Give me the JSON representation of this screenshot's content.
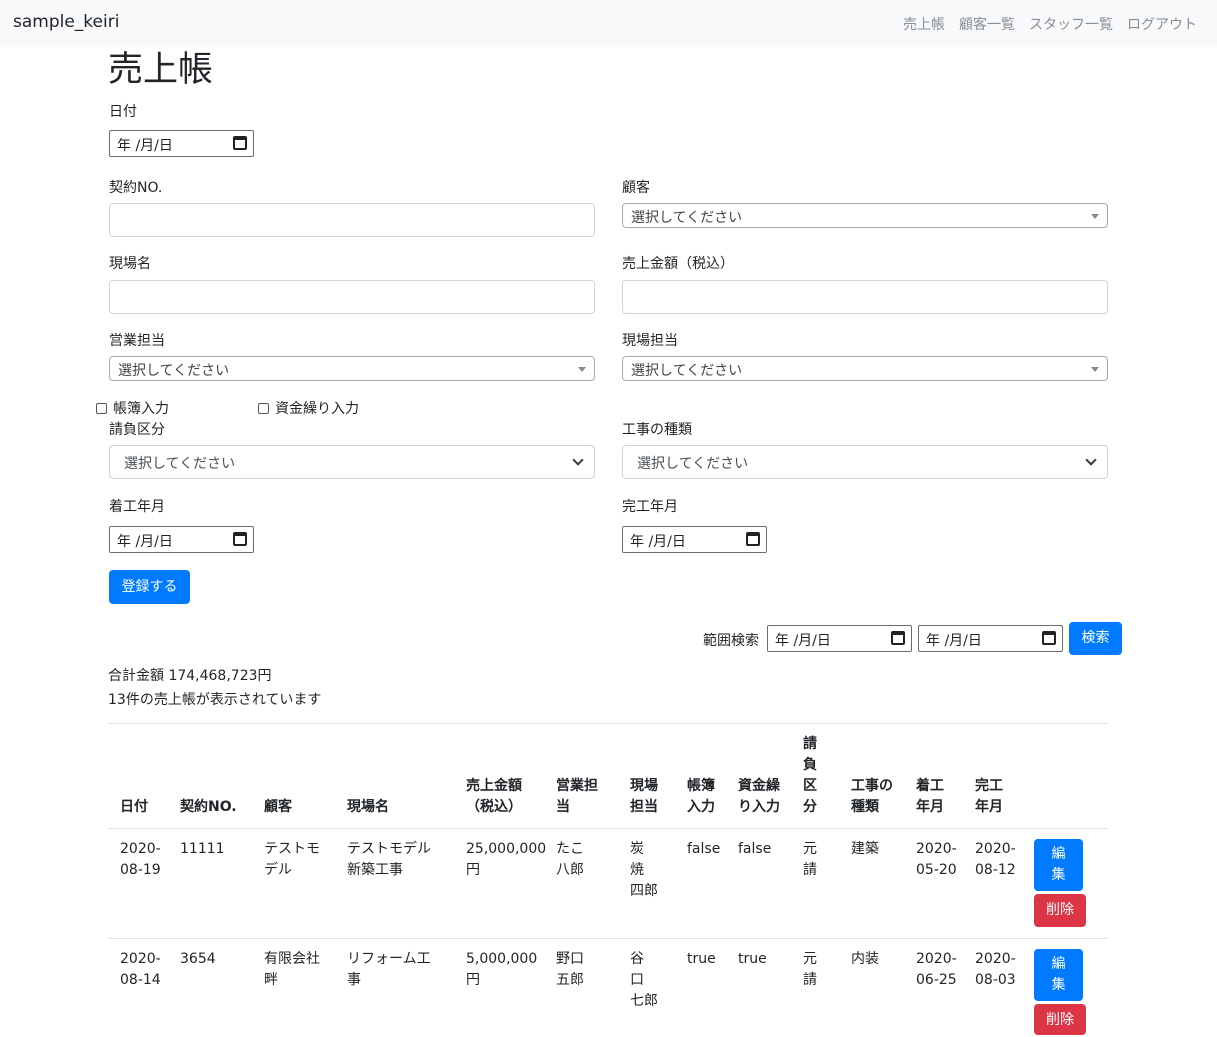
{
  "app": {
    "title": "sample_keiri"
  },
  "nav": {
    "items": [
      "売上帳",
      "顧客一覧",
      "スタッフ一覧",
      "ログアウト"
    ]
  },
  "page": {
    "title": "売上帳"
  },
  "form": {
    "date_label": "日付",
    "date_placeholder": "年 /月/日",
    "contract_label": "契約NO.",
    "customer_label": "顧客",
    "customer_placeholder": "選択してください",
    "site_label": "現場名",
    "amount_label": "売上金額（税込）",
    "sales_label": "営業担当",
    "sales_placeholder": "選択してください",
    "site_staff_label": "現場担当",
    "site_staff_placeholder": "選択してください",
    "ledger_checkbox": "帳簿入力",
    "cashflow_checkbox": "資金繰り入力",
    "contract_type_label": "請負区分",
    "contract_type_placeholder": "選択してください",
    "work_type_label": "工事の種類",
    "work_type_placeholder": "選択してください",
    "start_label": "着工年月",
    "start_placeholder": "年 /月/日",
    "finish_label": "完工年月",
    "finish_placeholder": "年 /月/日",
    "submit_label": "登録する"
  },
  "search": {
    "label": "範囲検索",
    "from_placeholder": "年 /月/日",
    "to_placeholder": "年 /月/日",
    "button": "検索"
  },
  "summary": {
    "total": "合計金額  174,468,723円",
    "count": "13件の売上帳が表示されています"
  },
  "table": {
    "headers": {
      "date": "日付",
      "contract": "契約NO.",
      "customer": "顧客",
      "site": "現場名",
      "amount_1": "売上金額",
      "amount_2": "（税込）",
      "sales_1": "営業担",
      "sales_2": "当",
      "staff_1": "現場",
      "staff_2": "担当",
      "ledger_1": "帳簿",
      "ledger_2": "入力",
      "cash_1": "資金繰",
      "cash_2": "り入力",
      "ctype_1": "請",
      "ctype_2": "負",
      "ctype_3": "区",
      "ctype_4": "分",
      "wtype_1": "工事の",
      "wtype_2": "種類",
      "start_1": "着工",
      "start_2": "年月",
      "finish_1": "完工",
      "finish_2": "年月"
    },
    "rows": [
      {
        "date_1": "2020-",
        "date_2": "08-19",
        "contract": "11111",
        "customer_1": "テストモ",
        "customer_2": "デル",
        "site_1": "テストモデル",
        "site_2": "新築工事",
        "amount_1": "25,000,000",
        "amount_2": "円",
        "sales_1": "たこ",
        "sales_2": "八郎",
        "staff_1": "炭",
        "staff_2": "焼",
        "staff_3": "四郎",
        "ledger": "false",
        "cash": "false",
        "ctype_1": "元",
        "ctype_2": "請",
        "wtype": "建築",
        "start_1": "2020-",
        "start_2": "05-20",
        "finish_1": "2020-",
        "finish_2": "08-12",
        "edit_1": "編",
        "edit_2": "集",
        "delete": "削除"
      },
      {
        "date_1": "2020-",
        "date_2": "08-14",
        "contract": "3654",
        "customer_1": "有限会社",
        "customer_2": "畔",
        "site_1": "リフォーム工",
        "site_2": "事",
        "amount_1": "5,000,000",
        "amount_2": "円",
        "sales_1": "野口",
        "sales_2": "五郎",
        "staff_1": "谷",
        "staff_2": "口",
        "staff_3": "七郎",
        "ledger": "true",
        "cash": "true",
        "ctype_1": "元",
        "ctype_2": "請",
        "wtype": "内装",
        "start_1": "2020-",
        "start_2": "06-25",
        "finish_1": "2020-",
        "finish_2": "08-03",
        "edit_1": "編",
        "edit_2": "集",
        "delete": "削除"
      }
    ]
  },
  "colors": {
    "primary": "#007bff",
    "danger": "#dc3545",
    "navbar_bg": "#f8f9fa"
  }
}
